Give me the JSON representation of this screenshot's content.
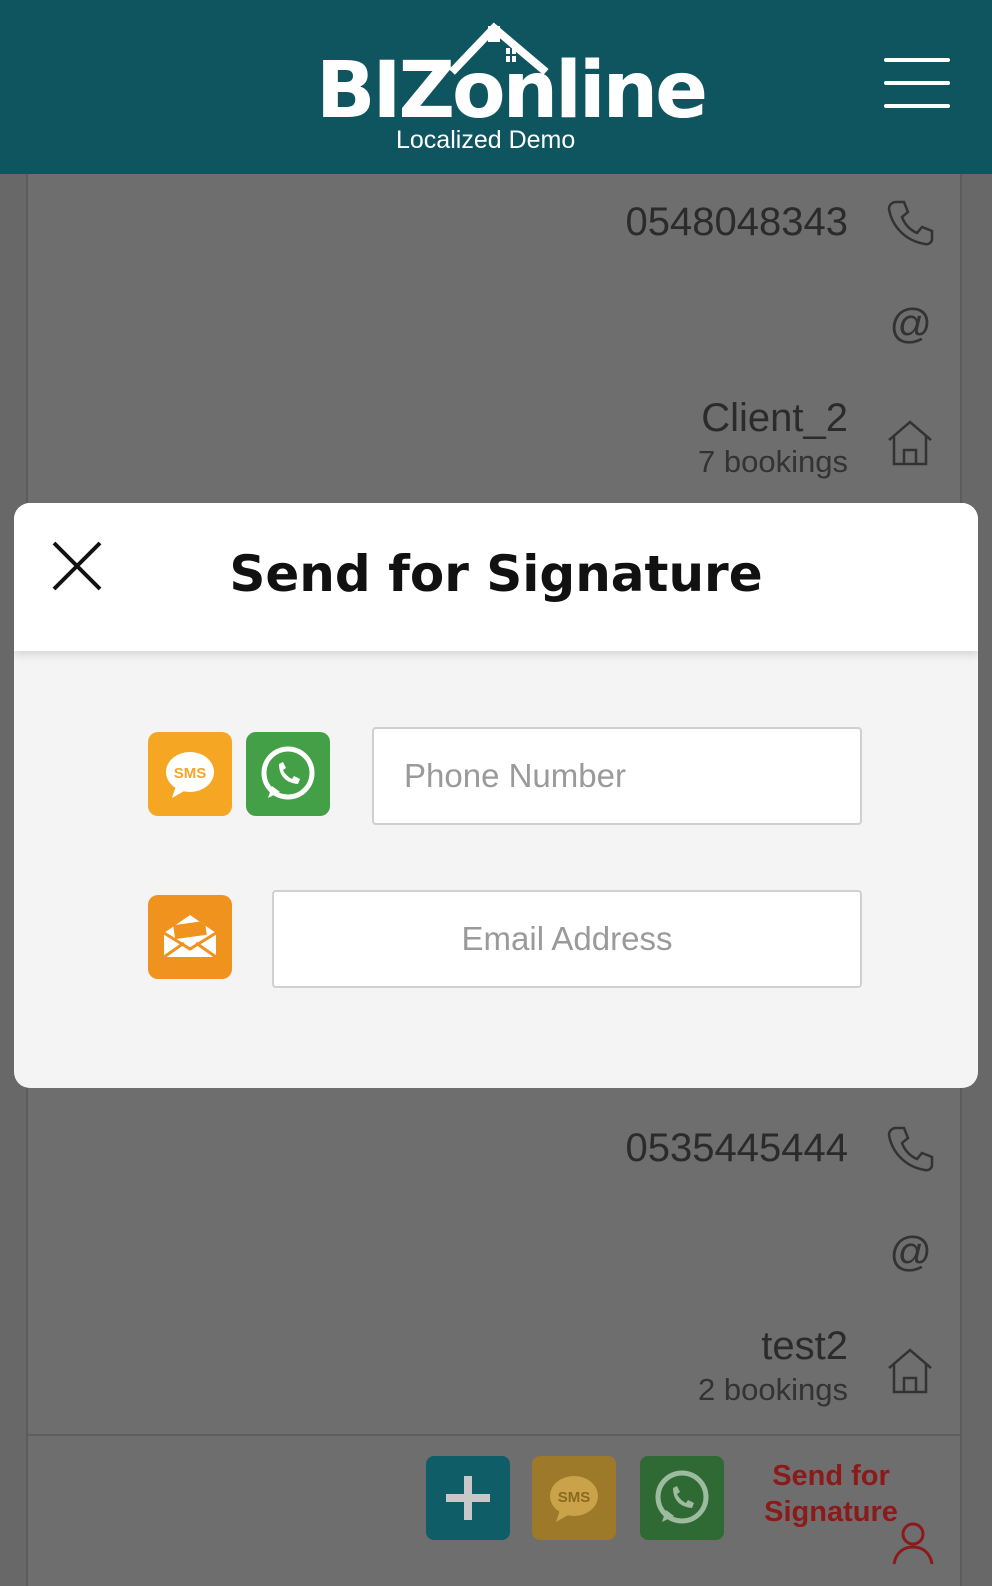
{
  "header": {
    "brand": "BIZonline",
    "subtitle": "Localized Demo"
  },
  "background_list": {
    "rows": [
      {
        "phone": "0548048343",
        "email_symbol": "@",
        "client_name": "Client_2",
        "bookings": "7 bookings"
      },
      {
        "phone": "0535445444",
        "email_symbol": "@",
        "client_name": "test2",
        "bookings": "2 bookings"
      }
    ],
    "actions": {
      "add_symbol": "+",
      "sms_label": "SMS",
      "send_for_signature": "Send for Signature"
    }
  },
  "modal": {
    "title": "Send for Signature",
    "sms_label": "SMS",
    "phone_placeholder": "Phone Number",
    "email_placeholder": "Email Address"
  },
  "colors": {
    "header_bg": "#0f5560",
    "sms_orange": "#f5a623",
    "whatsapp_green": "#43a047",
    "email_orange": "#f0921e",
    "add_teal": "#0f6b78",
    "signature_red": "#8c1a1a"
  },
  "icons": [
    "hamburger-icon",
    "phone-icon",
    "at-icon",
    "house-icon",
    "close-icon",
    "sms-icon",
    "whatsapp-icon",
    "envelope-icon",
    "plus-icon",
    "user-icon"
  ]
}
